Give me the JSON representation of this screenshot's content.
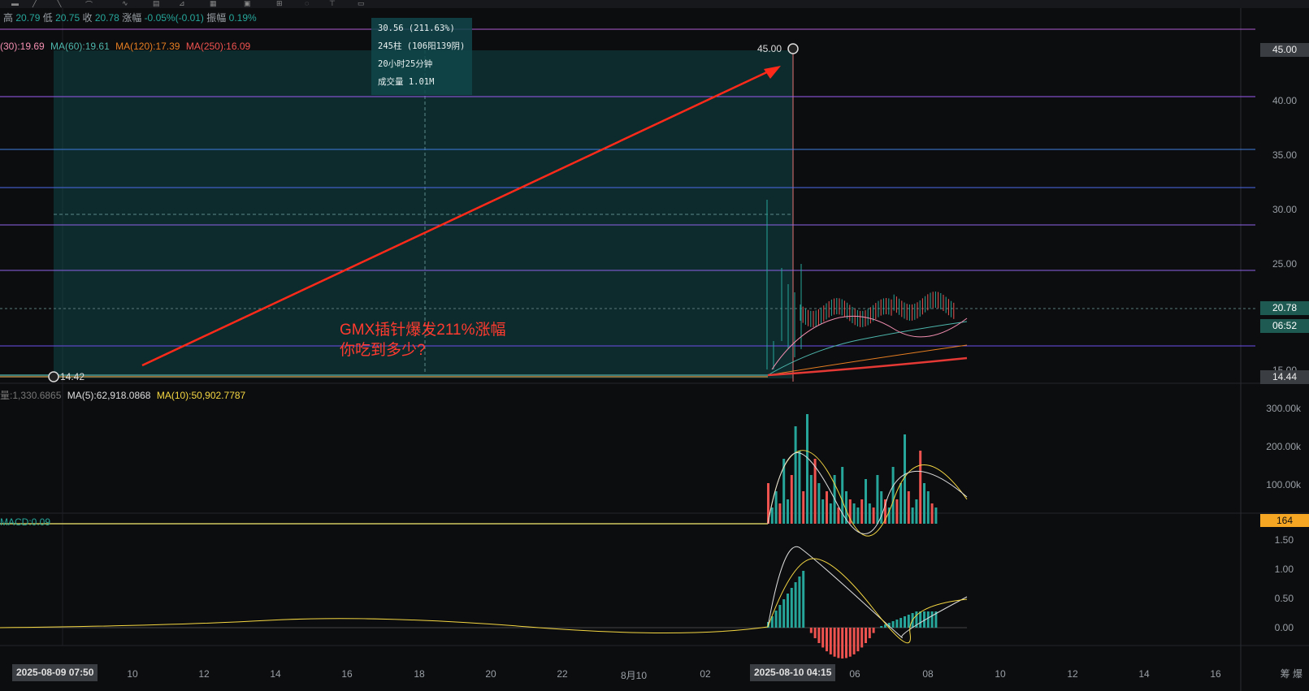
{
  "info_bar": {
    "high_label": "高",
    "high": "20.79",
    "low_label": "低",
    "low": "20.75",
    "close_label": "收",
    "close": "20.78",
    "change_label": "涨幅",
    "change": "-0.05%(-0.01)",
    "amp_label": "振幅",
    "amp": "0.19%"
  },
  "ma_bar": {
    "ma30": "(30):19.69",
    "ma60": "MA(60):19.61",
    "ma120": "MA(120):17.39",
    "ma250": "MA(250):16.09"
  },
  "measure_box": {
    "line1": "30.56 (211.63%)",
    "line2": "245柱 (106阳139阴)",
    "line3": "20小时25分钟",
    "line4": "成交量 1.01M"
  },
  "price_labels": {
    "top_point": "45.00",
    "bottom_point": "14.42"
  },
  "annotation": {
    "line1": "GMX插针爆发211%涨幅",
    "line2": "你吃到多少?"
  },
  "price_axis": [
    "45.00",
    "40.00",
    "35.00",
    "30.00",
    "25.00",
    "15.00"
  ],
  "price_tags": {
    "top": "45.00",
    "current": "20.78",
    "countdown": "06:52",
    "bottom": "14.44"
  },
  "volume_bar": {
    "vol": "量:1,330.6865",
    "ma5": "MA(5):62,918.0868",
    "ma10": "MA(10):50,902.7787"
  },
  "volume_axis": [
    "300.00k",
    "200.00k",
    "100.00k"
  ],
  "volume_tag": "164",
  "macd_bar": {
    "label": "MACD:0.09"
  },
  "macd_axis": [
    "1.50",
    "1.00",
    "0.50",
    "0.00"
  ],
  "time_axis": {
    "start_box": "2025-08-09 07:50",
    "ticks": [
      "10",
      "12",
      "14",
      "16",
      "18",
      "20",
      "22",
      "8月10",
      "02",
      "06",
      "08",
      "10",
      "12",
      "14",
      "16"
    ],
    "cursor_box": "2025-08-10 04:15",
    "right_icons": "筹 爆"
  },
  "colors": {
    "background": "#0c0d0f",
    "up": "#26a69a",
    "down": "#ef5350",
    "arrow": "#ff2a1a",
    "measure_fill": "#0f4a4c"
  }
}
